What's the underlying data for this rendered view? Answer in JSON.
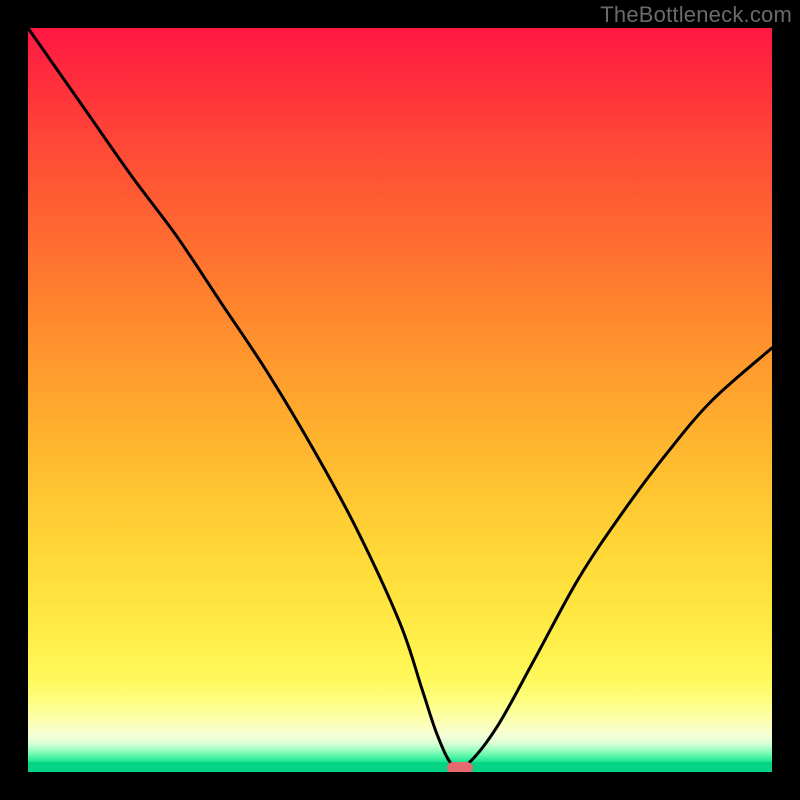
{
  "watermark": "TheBottleneck.com",
  "colors": {
    "frame": "#000000",
    "curve": "#000000",
    "marker": "#e46a6f",
    "gradient_top": "#ff1744",
    "gradient_mid": "#ffd737",
    "gradient_bottom": "#05d484"
  },
  "chart_data": {
    "type": "line",
    "title": "",
    "xlabel": "",
    "ylabel": "",
    "xlim": [
      0,
      100
    ],
    "ylim": [
      0,
      100
    ],
    "series": [
      {
        "name": "bottleneck-curve",
        "x": [
          0,
          7,
          14,
          20,
          26,
          32,
          38,
          44,
          50,
          53,
          55,
          57,
          59,
          63,
          68,
          74,
          80,
          86,
          92,
          100
        ],
        "values": [
          100,
          90,
          80,
          72,
          63,
          54,
          44,
          33,
          20,
          11,
          5,
          1,
          1,
          6,
          15,
          26,
          35,
          43,
          50,
          57
        ]
      }
    ],
    "marker": {
      "x": 58,
      "y": 0.5
    },
    "annotations": []
  }
}
